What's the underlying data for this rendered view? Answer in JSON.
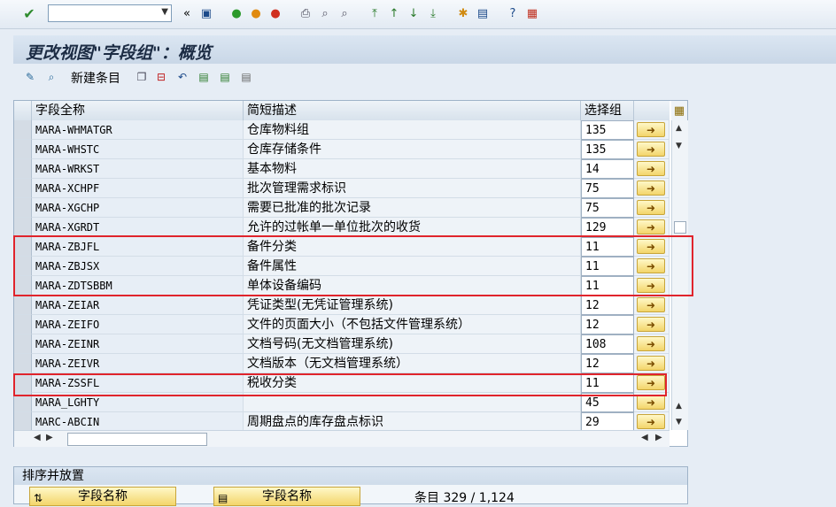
{
  "toolbar": {
    "command_value": "",
    "icons": [
      "check-icon",
      "dropdown-icon",
      "back-double-icon",
      "save-icon",
      "back-icon",
      "exit-icon",
      "cancel-icon",
      "print-icon",
      "find-icon",
      "find-next-icon",
      "first-page-icon",
      "prev-page-icon",
      "next-page-icon",
      "last-page-icon",
      "new-session-icon",
      "shortcut-icon",
      "help-icon",
      "layout-icon"
    ]
  },
  "title": "更改视图\"字段组\"：概览",
  "app_toolbar": {
    "new_entry_label": "新建条目"
  },
  "table": {
    "headers": [
      "字段全称",
      "简短描述",
      "选择组"
    ],
    "rows": [
      {
        "field": "MARA-WHMATGR",
        "desc": "仓库物料组",
        "group": "135"
      },
      {
        "field": "MARA-WHSTC",
        "desc": "仓库存储条件",
        "group": "135"
      },
      {
        "field": "MARA-WRKST",
        "desc": "基本物料",
        "group": "14"
      },
      {
        "field": "MARA-XCHPF",
        "desc": "批次管理需求标识",
        "group": "75"
      },
      {
        "field": "MARA-XGCHP",
        "desc": "需要已批准的批次记录",
        "group": "75"
      },
      {
        "field": "MARA-XGRDT",
        "desc": "允许的过帐单一单位批次的收货",
        "group": "129"
      },
      {
        "field": "MARA-ZBJFL",
        "desc": "备件分类",
        "group": "11"
      },
      {
        "field": "MARA-ZBJSX",
        "desc": "备件属性",
        "group": "11"
      },
      {
        "field": "MARA-ZDTSBBM",
        "desc": "单体设备编码",
        "group": "11"
      },
      {
        "field": "MARA-ZEIAR",
        "desc": "凭证类型(无凭证管理系统)",
        "group": "12"
      },
      {
        "field": "MARA-ZEIFO",
        "desc": "文件的页面大小（不包括文件管理系统）",
        "group": "12"
      },
      {
        "field": "MARA-ZEINR",
        "desc": "文档号码(无文档管理系统)",
        "group": "108"
      },
      {
        "field": "MARA-ZEIVR",
        "desc": "文档版本（无文档管理系统）",
        "group": "12"
      },
      {
        "field": "MARA-ZSSFL",
        "desc": "税收分类",
        "group": "11"
      },
      {
        "field": "MARA_LGHTY",
        "desc": "",
        "group": "45"
      },
      {
        "field": "MARC-ABCIN",
        "desc": "周期盘点的库存盘点标识",
        "group": "29"
      }
    ]
  },
  "sort_panel": {
    "title": "排序并放置",
    "button1": "字段名称",
    "button2": "字段名称",
    "entries_label": "条目 329 / 1,124"
  },
  "colors": {
    "highlight_box": "#e0242c",
    "button_yellow": "#f3d56a"
  }
}
